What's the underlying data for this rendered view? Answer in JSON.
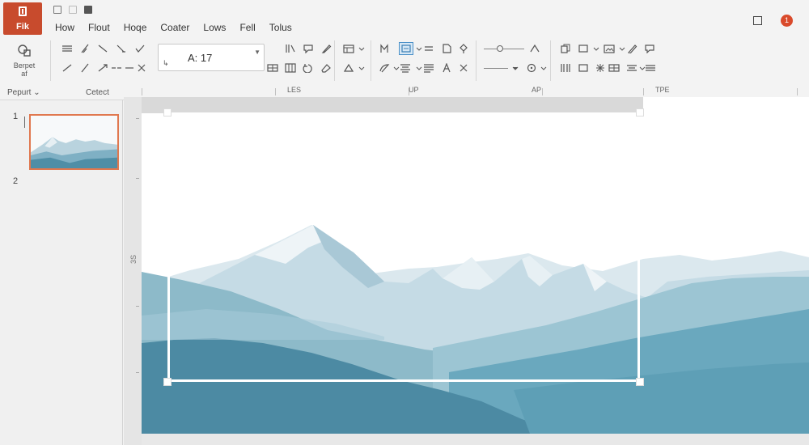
{
  "app": {
    "file_label": "Fik"
  },
  "menu": {
    "tabs": [
      "How",
      "Flout",
      "Hoqe",
      "Coater",
      "Lows",
      "Fell",
      "Tolus"
    ],
    "notification_count": "1"
  },
  "ribbon": {
    "paste_label_line1": "Berpet",
    "paste_label_line2": "af",
    "font_size_value": "A: 17",
    "group_labels": [
      "Pepurt",
      "Cetect"
    ],
    "ruler_labels": [
      "LES",
      "UP",
      "AP",
      "TPE"
    ]
  },
  "slides_panel": {
    "slides": [
      {
        "number": "1"
      },
      {
        "number": "2"
      }
    ]
  },
  "canvas": {
    "vertical_ruler_label": "3S"
  },
  "colors": {
    "file_button": "#c84b2d",
    "notification": "#d94a2b",
    "thumbnail_border": "#e0784f",
    "mountain_dark": "#4f8ea6",
    "mountain_light": "#c9dde6"
  }
}
